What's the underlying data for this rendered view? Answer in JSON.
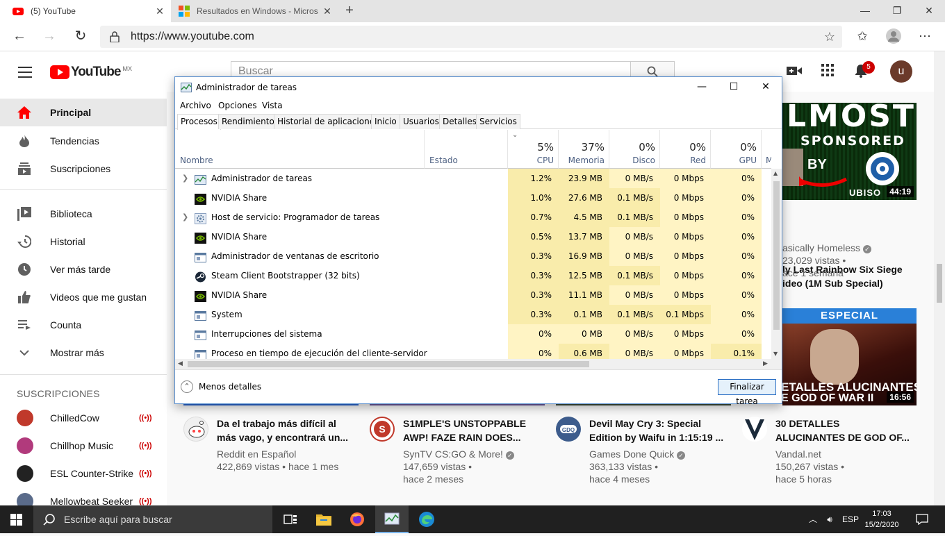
{
  "browser": {
    "tabs": [
      {
        "title": "(5) YouTube",
        "active": true
      },
      {
        "title": "Resultados en Windows - Micros",
        "active": false
      }
    ],
    "url": "https://www.youtube.com"
  },
  "youtube": {
    "logo_text": "YouTube",
    "region": "MX",
    "search_placeholder": "Buscar",
    "notifications": "5",
    "avatar_letter": "u",
    "sidebar": {
      "main": [
        {
          "label": "Principal",
          "icon": "home-icon",
          "active": true
        },
        {
          "label": "Tendencias",
          "icon": "fire-icon"
        },
        {
          "label": "Suscripciones",
          "icon": "subscriptions-icon"
        }
      ],
      "library": [
        {
          "label": "Biblioteca",
          "icon": "library-icon"
        },
        {
          "label": "Historial",
          "icon": "history-icon"
        },
        {
          "label": "Ver más tarde",
          "icon": "clock-icon"
        },
        {
          "label": "Videos que me gustan",
          "icon": "thumbs-up-icon"
        },
        {
          "label": "Counta",
          "icon": "playlist-icon"
        },
        {
          "label": "Mostrar más",
          "icon": "chevron-down-icon"
        }
      ],
      "subscriptions_header": "SUSCRIPCIONES",
      "subscriptions": [
        {
          "name": "ChilledCow",
          "color": "#c0392b"
        },
        {
          "name": "Chillhop Music",
          "color": "#b13a7c"
        },
        {
          "name": "ESL Counter-Strike",
          "color": "#222222"
        },
        {
          "name": "Mellowbeat Seeker",
          "color": "#5a6b8a"
        }
      ]
    },
    "right_video": {
      "thumb_text_top": "LMOST",
      "thumb_text_mid": "SPONSORED",
      "thumb_text_by": "BY",
      "thumb_brand": "UBISO",
      "duration": "44:19",
      "title_line1": "ly Last Rainbow Six Siege",
      "title_line2": "ideo (1M Sub Special)",
      "channel": "asically Homeless",
      "views": "23,029 vistas •",
      "age": "ace 1 semana"
    },
    "right_video2": {
      "banner": "ESPECIAL",
      "line1": "ETALLES ALUCINANTES",
      "line2": "E GOD OF WAR II",
      "duration": "16:56"
    },
    "videos": [
      {
        "title1": "Da el trabajo más difícil al",
        "title2": "más vago, y encontrará un...",
        "channel": "Reddit en Español",
        "verified": false,
        "views": "422,869 vistas • hace 1 mes",
        "age": "",
        "avatar_color": "#f0f0f0"
      },
      {
        "title1": "S1MPLE'S UNSTOPPABLE",
        "title2": "AWP! FAZE RAIN DOES...",
        "channel": "SynTV CS:GO & More!",
        "verified": true,
        "views": "147,659 vistas •",
        "age": "hace 2 meses",
        "avatar_color": "#c0392b"
      },
      {
        "title1": "Devil May Cry 3: Special",
        "title2": "Edition by Waifu in 1:15:19 ...",
        "channel": "Games Done Quick",
        "verified": true,
        "views": "363,133 vistas •",
        "age": "hace 4 meses",
        "avatar_color": "#3d5c8c"
      },
      {
        "title1": "30 DETALLES",
        "title2": "ALUCINANTES DE GOD OF...",
        "channel": "Vandal.net",
        "verified": false,
        "views": "150,267 vistas •",
        "age": "hace 5 horas",
        "avatar_color": "#1b2a3a"
      }
    ]
  },
  "taskmgr": {
    "title": "Administrador de tareas",
    "menu": [
      "Archivo",
      "Opciones",
      "Vista"
    ],
    "tabs": [
      "Procesos",
      "Rendimiento",
      "Historial de aplicaciones",
      "Inicio",
      "Usuarios",
      "Detalles",
      "Servicios"
    ],
    "columns": {
      "name": "Nombre",
      "status": "Estado",
      "cpu": {
        "pct": "5%",
        "label": "CPU"
      },
      "mem": {
        "pct": "37%",
        "label": "Memoria"
      },
      "disk": {
        "pct": "0%",
        "label": "Disco"
      },
      "net": {
        "pct": "0%",
        "label": "Red"
      },
      "gpu": {
        "pct": "0%",
        "label": "GPU"
      },
      "more": "Mot"
    },
    "processes": [
      {
        "name": "Administrador de tareas",
        "expand": true,
        "icon": "taskmgr-icon",
        "cpu": "1.2%",
        "mem": "23.9 MB",
        "disk": "0 MB/s",
        "net": "0 Mbps",
        "gpu": "0%"
      },
      {
        "name": "NVIDIA Share",
        "expand": false,
        "icon": "nvidia-icon",
        "cpu": "1.0%",
        "mem": "27.6 MB",
        "disk": "0.1 MB/s",
        "net": "0 Mbps",
        "gpu": "0%"
      },
      {
        "name": "Host de servicio: Programador de tareas",
        "expand": true,
        "icon": "gear-icon",
        "cpu": "0.7%",
        "mem": "4.5 MB",
        "disk": "0.1 MB/s",
        "net": "0 Mbps",
        "gpu": "0%"
      },
      {
        "name": "NVIDIA Share",
        "expand": false,
        "icon": "nvidia-icon",
        "cpu": "0.5%",
        "mem": "13.7 MB",
        "disk": "0 MB/s",
        "net": "0 Mbps",
        "gpu": "0%"
      },
      {
        "name": "Administrador de ventanas de escritorio",
        "expand": false,
        "icon": "window-icon",
        "cpu": "0.3%",
        "mem": "16.9 MB",
        "disk": "0 MB/s",
        "net": "0 Mbps",
        "gpu": "0%"
      },
      {
        "name": "Steam Client Bootstrapper (32 bits)",
        "expand": false,
        "icon": "steam-icon",
        "cpu": "0.3%",
        "mem": "12.5 MB",
        "disk": "0.1 MB/s",
        "net": "0 Mbps",
        "gpu": "0%"
      },
      {
        "name": "NVIDIA Share",
        "expand": false,
        "icon": "nvidia-icon",
        "cpu": "0.3%",
        "mem": "11.1 MB",
        "disk": "0 MB/s",
        "net": "0 Mbps",
        "gpu": "0%"
      },
      {
        "name": "System",
        "expand": false,
        "icon": "window-icon",
        "cpu": "0.3%",
        "mem": "0.1 MB",
        "disk": "0.1 MB/s",
        "net": "0.1 Mbps",
        "gpu": "0%"
      },
      {
        "name": "Interrupciones del sistema",
        "expand": false,
        "icon": "window-icon",
        "cpu": "0%",
        "mem": "0 MB",
        "disk": "0 MB/s",
        "net": "0 Mbps",
        "gpu": "0%"
      },
      {
        "name": "Proceso en tiempo de ejecución del cliente-servidor",
        "expand": false,
        "icon": "window-icon",
        "cpu": "0%",
        "mem": "0.6 MB",
        "disk": "0 MB/s",
        "net": "0 Mbps",
        "gpu": "0.1%"
      }
    ],
    "less_details": "Menos detalles",
    "end_task": "Finalizar tarea"
  },
  "taskbar": {
    "search_placeholder": "Escribe aquí para buscar",
    "lang": "ESP",
    "time": "17:03",
    "date": "15/2/2020"
  }
}
